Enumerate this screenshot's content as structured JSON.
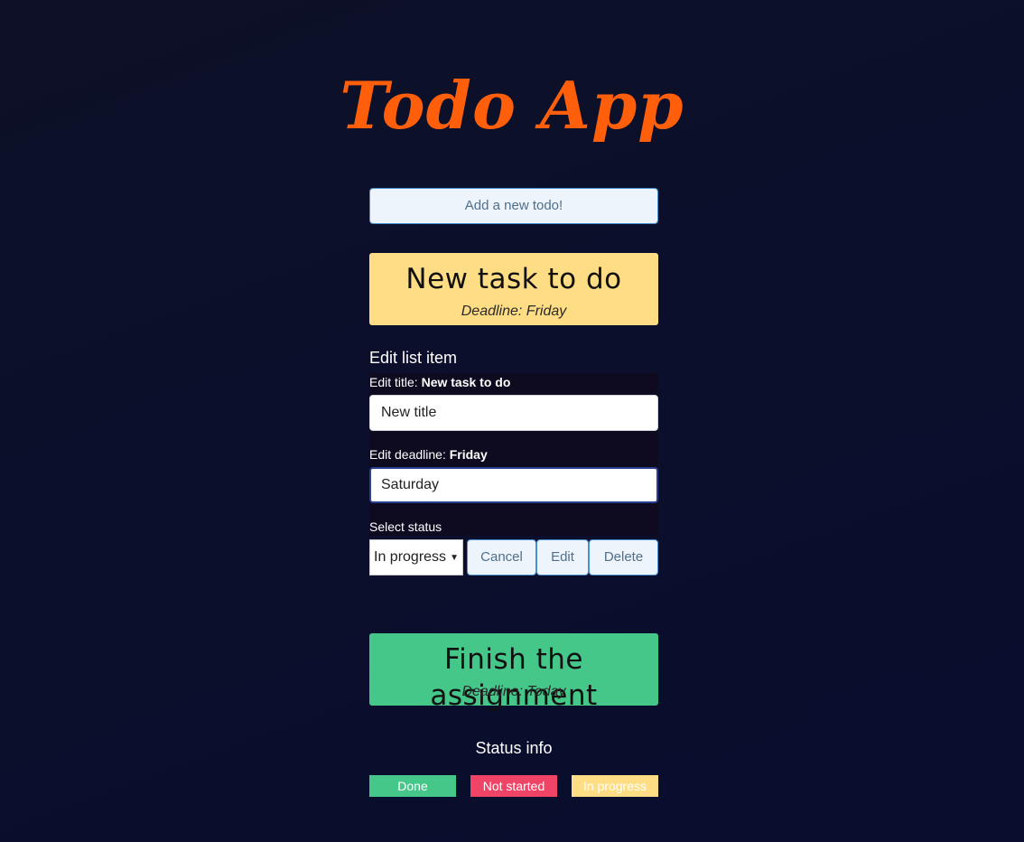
{
  "app": {
    "title": "Todo App"
  },
  "add_button": {
    "label": "Add a new todo!"
  },
  "todos": [
    {
      "title": "New task to do",
      "deadline": "Deadline: Friday",
      "color": "#ffdd85"
    },
    {
      "title": "Finish the assignment",
      "deadline": "Deadline: Today",
      "color": "#46c78a"
    }
  ],
  "edit": {
    "heading": "Edit list item",
    "title_label": "Edit title:",
    "title_current": "New task to do",
    "title_value": "New title",
    "deadline_label": "Edit deadline:",
    "deadline_current": "Friday",
    "deadline_value": "Saturday",
    "status_label": "Select status",
    "status_selected": "In progress",
    "cancel_label": "Cancel",
    "edit_label": "Edit",
    "delete_label": "Delete"
  },
  "status_info": {
    "title": "Status info",
    "items": [
      {
        "label": "Done",
        "color": "#46c78a"
      },
      {
        "label": "Not started",
        "color": "#ef4466"
      },
      {
        "label": "In progress",
        "color": "#ffdd85"
      }
    ]
  },
  "colors": {
    "title_accent": "#ff5f0a",
    "button_bg": "#eef4fb",
    "button_border": "#4a8fd0",
    "background": "#0b0f2c"
  }
}
